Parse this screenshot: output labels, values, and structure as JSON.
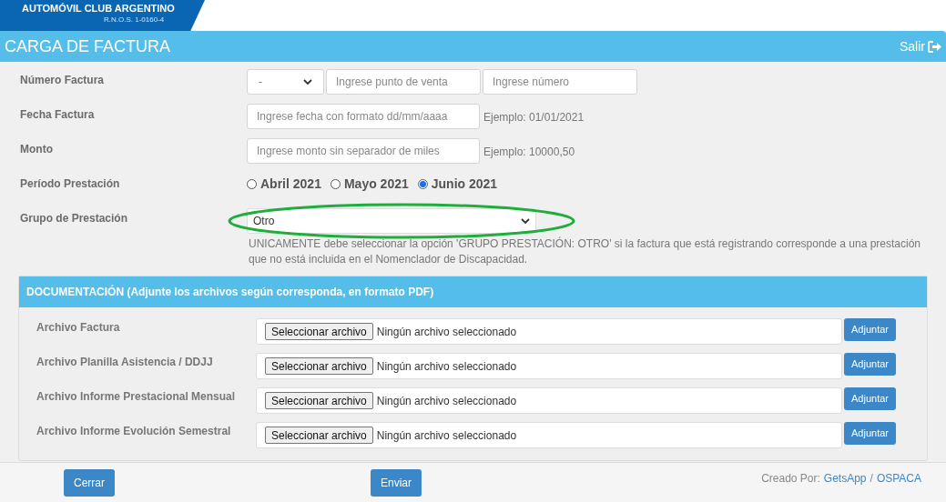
{
  "header": {
    "brand": "AUTOMÓVIL CLUB ARGENTINO",
    "registry": "R.N.O.S. 1-0160-4"
  },
  "title": "CARGA DE FACTURA",
  "exit_label": "Salir",
  "fields": [
    {
      "kind": "invoice_number",
      "label": "Número Factura",
      "select_value": "-",
      "inputs": [
        {
          "placeholder": "Ingrese punto de venta"
        },
        {
          "placeholder": "Ingrese número"
        }
      ]
    },
    {
      "kind": "text",
      "label": "Fecha Factura",
      "placeholder": "Ingrese fecha con formato dd/mm/aaaa",
      "hint": "Ejemplo: 01/01/2021"
    },
    {
      "kind": "text",
      "label": "Monto",
      "placeholder": "Ingrese monto sin separador de miles",
      "hint": "Ejemplo: 10000,50"
    },
    {
      "kind": "radio",
      "label": "Período Prestación",
      "options": [
        {
          "label": "Abril 2021",
          "selected": false
        },
        {
          "label": "Mayo 2021",
          "selected": false
        },
        {
          "label": "Junio 2021",
          "selected": true
        }
      ]
    },
    {
      "kind": "select",
      "label": "Grupo de Prestación",
      "value": "Otro",
      "highlighted": true,
      "note": "UNICAMENTE debe seleccionar la opción 'GRUPO PRESTACIÓN: OTRO' si la factura que está registrando corresponde a una prestación que no está incluida en el Nomenclador de Discapacidad."
    }
  ],
  "documentation": {
    "title": "DOCUMENTACIÓN (Adjunte los archivos según corresponda, en formato PDF)",
    "rows": [
      {
        "label": "Archivo Factura",
        "button": "Seleccionar archivo",
        "status": "Ningún archivo seleccionado",
        "action": "Adjuntar"
      },
      {
        "label": "Archivo Planilla Asistencia / DDJJ",
        "button": "Seleccionar archivo",
        "status": "Ningún archivo seleccionado",
        "action": "Adjuntar"
      },
      {
        "label": "Archivo Informe Prestacional Mensual",
        "button": "Seleccionar archivo",
        "status": "Ningún archivo seleccionado",
        "action": "Adjuntar"
      },
      {
        "label": "Archivo Informe Evolución Semestral",
        "button": "Seleccionar archivo",
        "status": "Ningún archivo seleccionado",
        "action": "Adjuntar"
      }
    ]
  },
  "footer": {
    "buttons": [
      "Cerrar",
      "Enviar"
    ],
    "credit_prefix": "Creado Por:",
    "links": [
      "GetsApp",
      "OSPACA"
    ],
    "separator": "/"
  }
}
